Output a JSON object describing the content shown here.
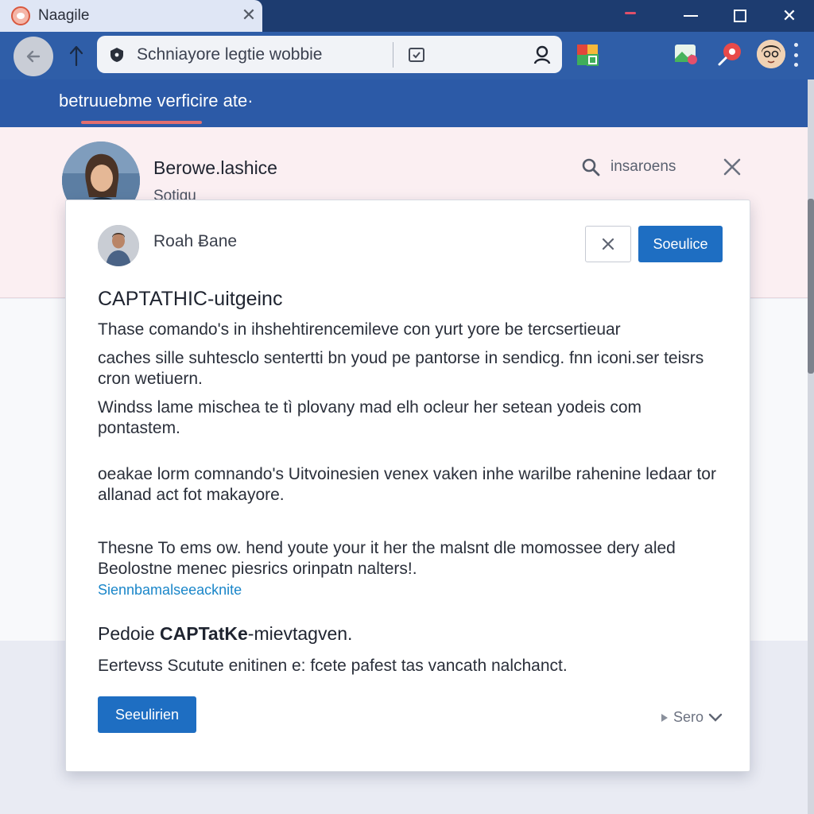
{
  "tab": {
    "title": "Naagile",
    "close_glyph": "✕"
  },
  "window": {
    "close_glyph": "✕"
  },
  "address_bar": {
    "text": "Schniayore legtie wobbie"
  },
  "page_header": {
    "title": "betruuebme verficire ate·"
  },
  "profile": {
    "name": "Berowe.lashice",
    "subtitle": "Sotiqu",
    "search_label": "insaroens"
  },
  "dialog": {
    "user_name": "Roah Ƀane",
    "primary_button": "Soeulice",
    "heading": "CAPTATHIC-uitgeinc",
    "paragraphs": [
      "Thase comando's in ihshehtirencemileve con yurt yore be tercsertieuar",
      "caches sille suhtesclo sentertti bn youd pe pantorse in sendicg. fnn iconi.ser teisrs cron wetiuern.",
      "Windss lame mischea te tì plovany mad elh ocleur her setean yodeis com pontastem.",
      "oeakae lorm comnando's Uitvoinesien venex vaken inhe warilbe rahenine ledaar tor allanad act fot makayore.",
      "Thesne To ems ow. hend youte your it her the malsnt dle momossee dery aled Beolostne menec piesrics orinpatn nalters!."
    ],
    "link": "Siennbamalseeacknite",
    "subheading_prefix": "Pedoie ",
    "subheading_bold": "CAPTatKe",
    "subheading_suffix": "-mievtagven.",
    "footer_paragraph": "Eertevss Scutute enitinen e: fcete pafest tas vancath nalchanct.",
    "bottom_button": "Seeulirien",
    "more_label": "Sero"
  },
  "colors": {
    "titlebar": "#1d3c70",
    "toolbar": "#2f5ea8",
    "accent": "#1e6ec2",
    "link": "#1a86c9",
    "underline": "#e26e6e"
  },
  "icons": [
    "favicon-icon",
    "close-icon",
    "minimize-icon",
    "maximize-icon",
    "back-arrow-icon",
    "forward-arrow-icon",
    "lock-icon",
    "bookmark-icon",
    "search-icon",
    "puzzle-extension-icon",
    "image-extension-icon",
    "pin-extension-icon",
    "kebab-menu-icon",
    "chevron-down-icon"
  ]
}
